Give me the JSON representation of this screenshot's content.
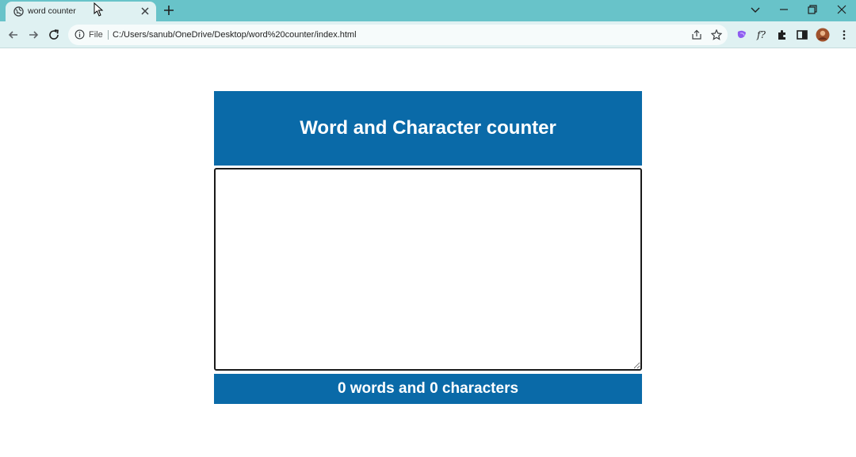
{
  "browser": {
    "tab_title": "word counter",
    "omnibox_scheme": "File",
    "url": "C:/Users/sanub/OneDrive/Desktop/word%20counter/index.html"
  },
  "app": {
    "title": "Word and Character counter",
    "textarea_value": "",
    "count_label": "0 words and 0 characters"
  },
  "colors": {
    "tabstrip": "#68c3c9",
    "toolbar": "#dff1f2",
    "accent": "#0a6aa8"
  },
  "icons": [
    "globe-icon",
    "close-icon",
    "plus-icon",
    "chevron-down-icon",
    "minimize-icon",
    "restore-icon",
    "window-close-icon",
    "back-icon",
    "forward-icon",
    "reload-icon",
    "info-icon",
    "share-icon",
    "star-icon",
    "extension-icon",
    "formula-icon",
    "puzzle-icon",
    "sidepanel-icon",
    "avatar",
    "menu-icon"
  ]
}
